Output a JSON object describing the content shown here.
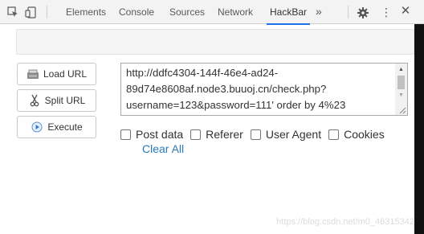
{
  "devtools": {
    "tabs": [
      {
        "label": "Elements",
        "active": false
      },
      {
        "label": "Console",
        "active": false
      },
      {
        "label": "Sources",
        "active": false
      },
      {
        "label": "Network",
        "active": false
      },
      {
        "label": "HackBar",
        "active": true
      }
    ],
    "more_tabs": "»",
    "icons": [
      "inspect-icon",
      "device-toggle-icon",
      "gear-icon",
      "kebab-menu-icon",
      "close-icon"
    ],
    "active_tab_color": "#1a73e8"
  },
  "hackbar": {
    "buttons": {
      "load_url": "Load URL",
      "split_url": "Split URL",
      "execute": "Execute"
    },
    "url_lines": [
      "http://ddfc4304-144f-46e4-ad24-",
      "89d74e8608af.node3.buuoj.cn/check.php?",
      "username=123&password=111' order by 4%23"
    ],
    "options": [
      {
        "label": "Post data",
        "checked": false
      },
      {
        "label": "Referer",
        "checked": false
      },
      {
        "label": "User Agent",
        "checked": false
      },
      {
        "label": "Cookies",
        "checked": false
      }
    ],
    "clear_all": "Clear All",
    "link_color": "#2a7ab8"
  },
  "watermark": "https://blog.csdn.net/m0_46315342"
}
